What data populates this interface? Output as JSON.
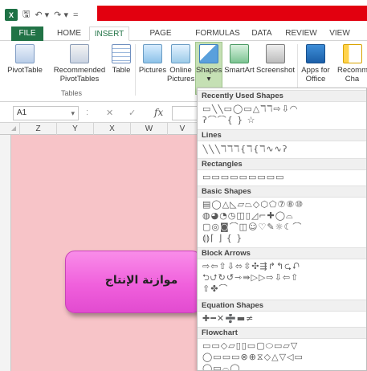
{
  "titlebar": {
    "qat_icons": [
      "excel-logo",
      "save-icon",
      "undo-icon",
      "redo-icon",
      "customize-icon"
    ],
    "excel_letters": "X",
    "save_glyph": "🖫",
    "undo_glyph": "↶ ▾",
    "redo_glyph": "↷ ▾",
    "customize_glyph": "="
  },
  "tabs": [
    "FILE",
    "HOME",
    "INSERT",
    "PAGE LAYOUT",
    "FORMULAS",
    "DATA",
    "REVIEW",
    "VIEW"
  ],
  "ribbon": {
    "pivot": "PivotTable",
    "recommended_pivot": "Recommended PivotTables",
    "table": "Table",
    "tables_group": "Tables",
    "pictures": "Pictures",
    "online_pictures": "Online Pictures",
    "shapes": "Shapes",
    "smartart": "SmartArt",
    "screenshot": "Screenshot",
    "apps_for_office": "Apps for Office",
    "dropdown_caret": "▾",
    "recomm_cut": "Recomm",
    "cha_cut": "Cha"
  },
  "formula_bar": {
    "name_box": "A1",
    "name_caret": "▾",
    "sep": ":",
    "cancel": "✕",
    "enter": "✓",
    "fx": "fx"
  },
  "columns": [
    "Z",
    "Y",
    "X",
    "W",
    "V"
  ],
  "shape_text": "موازنة الإنتاج",
  "gallery": {
    "sections": [
      {
        "title": "Recently Used Shapes",
        "rows": [
          "▭╲╲▭◯▭△ℸℸ⇨⇩◠",
          "ʔ⌒⌒{ } ☆"
        ]
      },
      {
        "title": "Lines",
        "rows": [
          "╲╲╲ℸℸℸ{ℸ{ℸ∿∿ʔ"
        ]
      },
      {
        "title": "Rectangles",
        "rows": [
          "▭▭▭▭▭▭▭▭▭"
        ]
      },
      {
        "title": "Basic Shapes",
        "rows": [
          "▤◯△◺▱⏢◇⬡⬠⑦⑧⑩",
          "◍◕◔◷◫▯◿⌐✚◯⌓",
          "▢◎◙⌒◫☺♡✎☼☾⌒",
          "⟬⟭⌈ ⌋ { }"
        ]
      },
      {
        "title": "Block Arrows",
        "rows": [
          "⇨⇦⇧⇩⬄⇳✣⇶↱↰⮎⮏",
          "⮌⮍↻↺⇾⇛▷▷⇨⇩⇦⇧",
          "⇧✤⌒"
        ]
      },
      {
        "title": "Equation Shapes",
        "rows": [
          "✚━✕➗▬≠"
        ]
      },
      {
        "title": "Flowchart",
        "rows": [
          "▭▭◇▱▯▯▭▢⬭▭▱▽",
          "◯▭▭▭⊗⊕⧖◇△▽◁▭",
          "◯▭⌓◯"
        ]
      }
    ]
  }
}
